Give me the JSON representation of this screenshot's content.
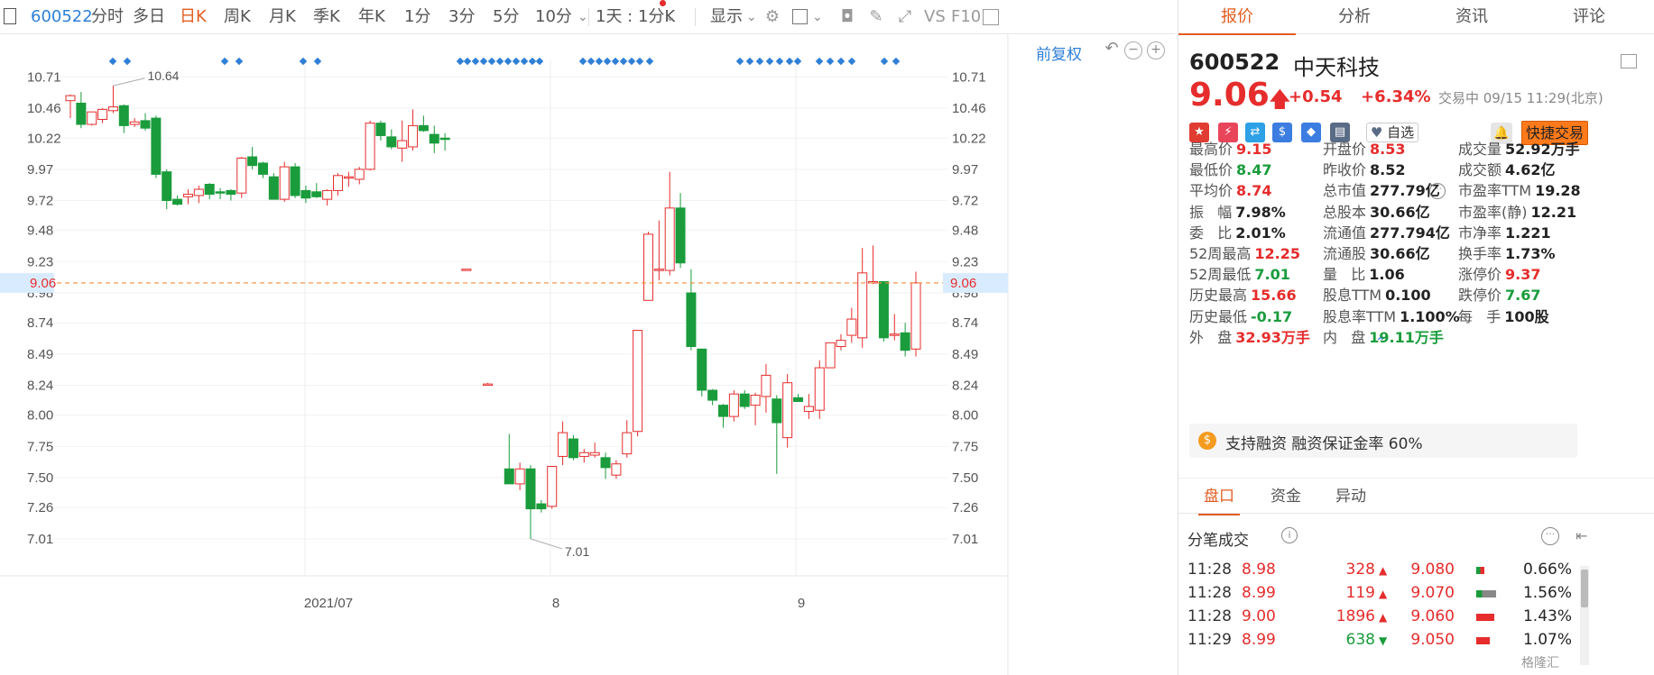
{
  "toolbar": {
    "code": "600522",
    "periods": [
      "分时",
      "多日",
      "日K",
      "周K",
      "月K",
      "季K",
      "年K",
      "1分",
      "3分",
      "5分",
      "10分"
    ],
    "active_period": "日K",
    "range_select": "1天 : 1分K",
    "display_label": "显示",
    "vs_label": "VS",
    "f10_label": "F10"
  },
  "chart": {
    "fq_label": "前复权",
    "y_ticks": [
      "10.71",
      "10.46",
      "10.22",
      "9.97",
      "9.72",
      "9.48",
      "9.23",
      "8.98",
      "8.74",
      "8.49",
      "8.24",
      "8.00",
      "7.75",
      "7.50",
      "7.26",
      "7.01"
    ],
    "current_price_tag": "9.06",
    "x_labels": [
      "2021/07",
      "8",
      "9"
    ],
    "high_annotation": "10.64",
    "low_annotation": "7.01",
    "colors": {
      "up": "#e62c2c",
      "down": "#1a9c3c",
      "price_line": "#f58b3b",
      "marker": "#2f7fd6"
    }
  },
  "chart_data": {
    "type": "candlestick",
    "ylim": [
      6.85,
      10.85
    ],
    "candles": [
      {
        "o": 10.52,
        "h": 10.57,
        "l": 10.38,
        "c": 10.56
      },
      {
        "o": 10.5,
        "h": 10.59,
        "l": 10.3,
        "c": 10.33
      },
      {
        "o": 10.33,
        "h": 10.43,
        "l": 10.32,
        "c": 10.43
      },
      {
        "o": 10.37,
        "h": 10.46,
        "l": 10.34,
        "c": 10.45
      },
      {
        "o": 10.44,
        "h": 10.64,
        "l": 10.42,
        "c": 10.47
      },
      {
        "o": 10.48,
        "h": 10.49,
        "l": 10.26,
        "c": 10.32
      },
      {
        "o": 10.33,
        "h": 10.38,
        "l": 10.31,
        "c": 10.35
      },
      {
        "o": 10.36,
        "h": 10.42,
        "l": 10.28,
        "c": 10.3
      },
      {
        "o": 10.38,
        "h": 10.4,
        "l": 9.9,
        "c": 9.93
      },
      {
        "o": 9.95,
        "h": 9.97,
        "l": 9.65,
        "c": 9.72
      },
      {
        "o": 9.73,
        "h": 9.76,
        "l": 9.68,
        "c": 9.69
      },
      {
        "o": 9.75,
        "h": 9.81,
        "l": 9.69,
        "c": 9.77
      },
      {
        "o": 9.76,
        "h": 9.84,
        "l": 9.7,
        "c": 9.81
      },
      {
        "o": 9.85,
        "h": 9.86,
        "l": 9.73,
        "c": 9.77
      },
      {
        "o": 9.79,
        "h": 9.82,
        "l": 9.73,
        "c": 9.78
      },
      {
        "o": 9.8,
        "h": 9.81,
        "l": 9.72,
        "c": 9.77
      },
      {
        "o": 9.78,
        "h": 10.07,
        "l": 9.74,
        "c": 10.06
      },
      {
        "o": 10.07,
        "h": 10.15,
        "l": 9.97,
        "c": 10.0
      },
      {
        "o": 10.02,
        "h": 10.03,
        "l": 9.9,
        "c": 9.93
      },
      {
        "o": 9.91,
        "h": 9.94,
        "l": 9.73,
        "c": 9.73
      },
      {
        "o": 9.73,
        "h": 10.03,
        "l": 9.71,
        "c": 9.99
      },
      {
        "o": 9.99,
        "h": 10.02,
        "l": 9.74,
        "c": 9.76
      },
      {
        "o": 9.8,
        "h": 9.84,
        "l": 9.7,
        "c": 9.74
      },
      {
        "o": 9.79,
        "h": 9.86,
        "l": 9.74,
        "c": 9.75
      },
      {
        "o": 9.73,
        "h": 9.81,
        "l": 9.68,
        "c": 9.8
      },
      {
        "o": 9.8,
        "h": 9.94,
        "l": 9.76,
        "c": 9.92
      },
      {
        "o": 9.9,
        "h": 9.95,
        "l": 9.83,
        "c": 9.91
      },
      {
        "o": 9.89,
        "h": 9.99,
        "l": 9.85,
        "c": 9.97
      },
      {
        "o": 9.97,
        "h": 10.36,
        "l": 9.96,
        "c": 10.34
      },
      {
        "o": 10.34,
        "h": 10.36,
        "l": 10.2,
        "c": 10.24
      },
      {
        "o": 10.23,
        "h": 10.29,
        "l": 10.13,
        "c": 10.15
      },
      {
        "o": 10.14,
        "h": 10.36,
        "l": 10.03,
        "c": 10.2
      },
      {
        "o": 10.15,
        "h": 10.45,
        "l": 10.12,
        "c": 10.32
      },
      {
        "o": 10.32,
        "h": 10.4,
        "l": 10.27,
        "c": 10.28
      },
      {
        "o": 10.25,
        "h": 10.32,
        "l": 10.1,
        "c": 10.18
      },
      {
        "o": 10.22,
        "h": 10.26,
        "l": 10.12,
        "c": 10.21
      },
      {
        "o": null,
        "h": null,
        "l": null,
        "c": null
      },
      {
        "o": 9.16,
        "h": 9.17,
        "l": 9.16,
        "c": 9.17
      },
      {
        "o": null,
        "h": null,
        "l": null,
        "c": null
      },
      {
        "o": 8.25,
        "h": 8.26,
        "l": 8.25,
        "c": 8.25
      },
      {
        "o": null,
        "h": null,
        "l": null,
        "c": null
      },
      {
        "o": 7.57,
        "h": 7.85,
        "l": 7.45,
        "c": 7.45
      },
      {
        "o": 7.45,
        "h": 7.62,
        "l": 7.4,
        "c": 7.57
      },
      {
        "o": 7.57,
        "h": 7.6,
        "l": 7.01,
        "c": 7.25
      },
      {
        "o": 7.29,
        "h": 7.32,
        "l": 7.22,
        "c": 7.25
      },
      {
        "o": 7.27,
        "h": 7.59,
        "l": 7.25,
        "c": 7.59
      },
      {
        "o": 7.67,
        "h": 7.95,
        "l": 7.6,
        "c": 7.86
      },
      {
        "o": 7.81,
        "h": 7.84,
        "l": 7.64,
        "c": 7.66
      },
      {
        "o": 7.67,
        "h": 7.73,
        "l": 7.62,
        "c": 7.7
      },
      {
        "o": 7.68,
        "h": 7.78,
        "l": 7.66,
        "c": 7.7
      },
      {
        "o": 7.66,
        "h": 7.7,
        "l": 7.49,
        "c": 7.58
      },
      {
        "o": 7.52,
        "h": 7.64,
        "l": 7.49,
        "c": 7.61
      },
      {
        "o": 7.69,
        "h": 7.96,
        "l": 7.66,
        "c": 7.86
      },
      {
        "o": 7.87,
        "h": 8.68,
        "l": 7.83,
        "c": 8.68
      },
      {
        "o": 8.92,
        "h": 9.47,
        "l": 9.06,
        "c": 9.45
      },
      {
        "o": 9.17,
        "h": 9.56,
        "l": 9.08,
        "c": 9.17
      },
      {
        "o": 9.16,
        "h": 9.95,
        "l": 9.12,
        "c": 9.66
      },
      {
        "o": 9.66,
        "h": 9.78,
        "l": 9.18,
        "c": 9.22
      },
      {
        "o": 8.98,
        "h": 9.17,
        "l": 8.52,
        "c": 8.55
      },
      {
        "o": 8.53,
        "h": 8.53,
        "l": 8.15,
        "c": 8.2
      },
      {
        "o": 8.2,
        "h": 8.21,
        "l": 8.08,
        "c": 8.12
      },
      {
        "o": 8.08,
        "h": 8.09,
        "l": 7.9,
        "c": 7.99
      },
      {
        "o": 7.99,
        "h": 8.2,
        "l": 7.95,
        "c": 8.17
      },
      {
        "o": 8.17,
        "h": 8.2,
        "l": 8.05,
        "c": 8.07
      },
      {
        "o": 8.08,
        "h": 8.18,
        "l": 7.92,
        "c": 8.16
      },
      {
        "o": 8.15,
        "h": 8.41,
        "l": 8.02,
        "c": 8.32
      },
      {
        "o": 8.13,
        "h": 8.16,
        "l": 7.53,
        "c": 7.94
      },
      {
        "o": 7.82,
        "h": 8.33,
        "l": 7.74,
        "c": 8.26
      },
      {
        "o": 8.14,
        "h": 8.17,
        "l": 8.11,
        "c": 8.11
      },
      {
        "o": 8.03,
        "h": 8.17,
        "l": 7.97,
        "c": 8.07
      },
      {
        "o": 8.04,
        "h": 8.44,
        "l": 7.97,
        "c": 8.38
      },
      {
        "o": 8.38,
        "h": 8.52,
        "l": 8.39,
        "c": 8.58
      },
      {
        "o": 8.55,
        "h": 8.65,
        "l": 8.52,
        "c": 8.6
      },
      {
        "o": 8.64,
        "h": 8.86,
        "l": 8.58,
        "c": 8.77
      },
      {
        "o": 8.62,
        "h": 9.34,
        "l": 8.54,
        "c": 9.14
      },
      {
        "o": 9.06,
        "h": 9.36,
        "l": 9.05,
        "c": 9.07
      },
      {
        "o": 9.07,
        "h": 9.07,
        "l": 8.59,
        "c": 8.62
      },
      {
        "o": 8.65,
        "h": 8.81,
        "l": 8.6,
        "c": 8.65
      },
      {
        "o": 8.66,
        "h": 8.74,
        "l": 8.47,
        "c": 8.52
      },
      {
        "o": 8.53,
        "h": 9.15,
        "l": 8.47,
        "c": 9.06
      }
    ]
  },
  "tabs": [
    "报价",
    "分析",
    "资讯",
    "评论"
  ],
  "active_tab": "报价",
  "stock": {
    "code": "600522",
    "name": "中天科技",
    "price": "9.06",
    "change": "+0.54",
    "change_pct": "+6.34%",
    "status": "交易中 09/15 11:29(北京)",
    "watch_label": "自选",
    "quick_trade_label": "快捷交易"
  },
  "stats": [
    [
      {
        "label": "最高价",
        "value": "9.15",
        "color": "red"
      },
      {
        "label": "开盘价",
        "value": "8.53",
        "color": "red"
      },
      {
        "label": "成交量",
        "value": "52.92万手",
        "color": "dark"
      }
    ],
    [
      {
        "label": "最低价",
        "value": "8.47",
        "color": "green"
      },
      {
        "label": "昨收价",
        "value": "8.52",
        "color": "dark"
      },
      {
        "label": "成交额",
        "value": "4.62亿",
        "color": "dark"
      }
    ],
    [
      {
        "label": "平均价",
        "value": "8.74",
        "color": "red"
      },
      {
        "label": "总市值",
        "value": "277.79亿",
        "color": "dark"
      },
      {
        "label": "市盈率TTM",
        "value": "19.28",
        "color": "dark"
      }
    ],
    [
      {
        "label": "振   幅",
        "value": "7.98%",
        "color": "dark"
      },
      {
        "label": "总股本",
        "value": "30.66亿",
        "color": "dark"
      },
      {
        "label": "市盈率(静)",
        "value": "12.21",
        "color": "dark"
      }
    ],
    [
      {
        "label": "委   比",
        "value": "2.01%",
        "color": "dark"
      },
      {
        "label": "流通值",
        "value": "277.794亿",
        "color": "dark"
      },
      {
        "label": "市净率",
        "value": "1.221",
        "color": "dark"
      }
    ],
    [
      {
        "label": "52周最高",
        "value": "12.25",
        "color": "red"
      },
      {
        "label": "流通股",
        "value": "30.66亿",
        "color": "dark"
      },
      {
        "label": "换手率",
        "value": "1.73%",
        "color": "dark"
      }
    ],
    [
      {
        "label": "52周最低",
        "value": "7.01",
        "color": "green"
      },
      {
        "label": "量   比",
        "value": "1.06",
        "color": "dark"
      },
      {
        "label": "涨停价",
        "value": "9.37",
        "color": "red"
      }
    ],
    [
      {
        "label": "历史最高",
        "value": "15.66",
        "color": "red"
      },
      {
        "label": "股息TTM",
        "value": "0.100",
        "color": "dark"
      },
      {
        "label": "跌停价",
        "value": "7.67",
        "color": "green"
      }
    ],
    [
      {
        "label": "历史最低",
        "value": "-0.17",
        "color": "green"
      },
      {
        "label": "股息率TTM",
        "value": "1.100%",
        "color": "dark"
      },
      {
        "label": "每   手",
        "value": "100股",
        "color": "dark"
      }
    ],
    [
      {
        "label": "外   盘",
        "value": "32.93万手",
        "color": "red"
      },
      {
        "label": "内   盘",
        "value": "19.11万手",
        "color": "green"
      },
      {
        "label": "",
        "value": "",
        "color": "dark"
      }
    ]
  ],
  "margin": {
    "icon": "$",
    "text": "支持融资 融资保证金率 60%"
  },
  "sub_tabs": [
    "盘口",
    "资金",
    "异动"
  ],
  "active_sub_tab": "盘口",
  "ticks": {
    "title": "分笔成交",
    "rows": [
      {
        "time": "11:28",
        "price": "8.98",
        "volume": "328",
        "dir": "up",
        "level": "9.080",
        "pct": "0.66%",
        "bar_share": 0.35
      },
      {
        "time": "11:28",
        "price": "8.99",
        "volume": "119",
        "dir": "up",
        "level": "9.070",
        "pct": "1.56%",
        "bar_share": 0.85
      },
      {
        "time": "11:28",
        "price": "9.00",
        "volume": "1896",
        "dir": "up",
        "level": "9.060",
        "pct": "1.43%",
        "bar_share": 0.78
      },
      {
        "time": "11:29",
        "price": "8.99",
        "volume": "638",
        "dir": "down",
        "level": "9.050",
        "pct": "1.07%",
        "bar_share": 0.58
      }
    ]
  },
  "watermark": "格隆汇"
}
